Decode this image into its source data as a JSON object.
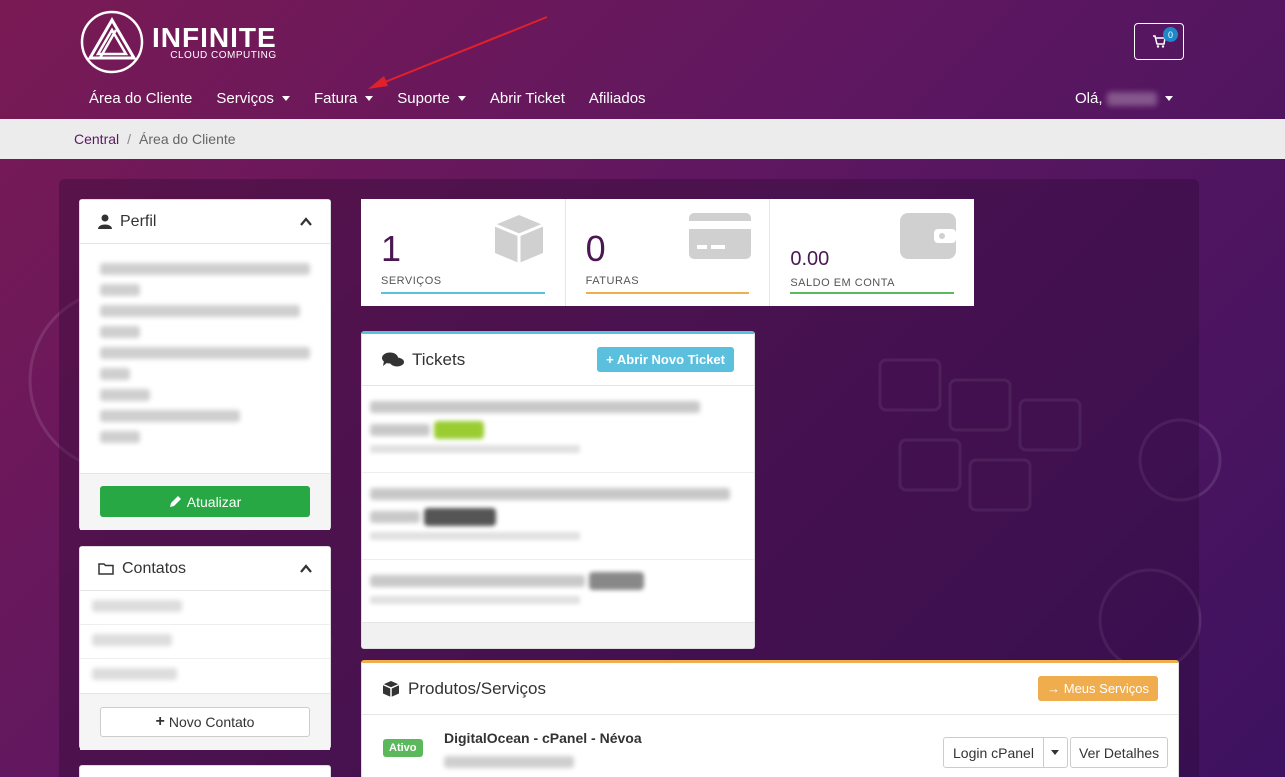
{
  "brand": {
    "title": "INFINITE",
    "subtitle": "CLOUD COMPUTING"
  },
  "cart": {
    "count": "0",
    "icon": "cart-icon"
  },
  "nav": {
    "items": [
      {
        "label": "Área do Cliente",
        "dropdown": false
      },
      {
        "label": "Serviços",
        "dropdown": true
      },
      {
        "label": "Fatura",
        "dropdown": true
      },
      {
        "label": "Suporte",
        "dropdown": true
      },
      {
        "label": "Abrir Ticket",
        "dropdown": false
      },
      {
        "label": "Afiliados",
        "dropdown": false
      }
    ],
    "greeting": "Olá,"
  },
  "breadcrumb": {
    "home": "Central",
    "current": "Área do Cliente"
  },
  "profile": {
    "title": "Perfil",
    "update_label": "Atualizar"
  },
  "contacts": {
    "title": "Contatos",
    "new_label": "Novo Contato"
  },
  "stats": [
    {
      "value": "1",
      "label": "SERVIÇOS",
      "color": "#5bc0de",
      "icon": "box-icon"
    },
    {
      "value": "0",
      "label": "FATURAS",
      "color": "#f0ad4e",
      "icon": "credit-card-icon"
    },
    {
      "value": "0.00",
      "label": "SALDO EM CONTA",
      "color": "#5cb85c",
      "icon": "wallet-icon"
    }
  ],
  "tickets": {
    "title": "Tickets",
    "new_label": "Abrir Novo Ticket"
  },
  "products": {
    "title": "Produtos/Serviços",
    "my_services_label": "Meus Serviços",
    "item": {
      "status": "Ativo",
      "name": "DigitalOcean - cPanel - Névoa",
      "login_label": "Login cPanel",
      "details_label": "Ver Detalhes"
    }
  },
  "colors": {
    "brand": "#5e1760",
    "accent_info": "#5bc0de",
    "accent_warning": "#f0ad4e",
    "accent_success": "#28a745"
  }
}
